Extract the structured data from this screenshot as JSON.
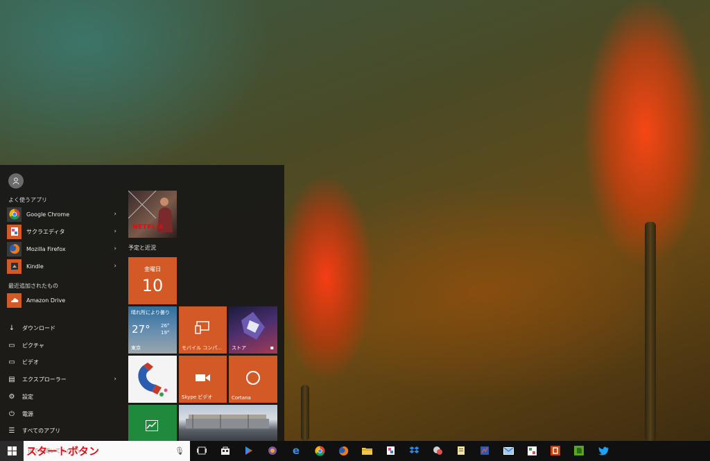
{
  "start_menu": {
    "frequent_label": "よく使うアプリ",
    "frequent_apps": [
      {
        "name": "Google Chrome",
        "icon": "chrome-icon"
      },
      {
        "name": "サクラエディタ",
        "icon": "sakura-editor-icon"
      },
      {
        "name": "Mozilla Firefox",
        "icon": "firefox-icon"
      },
      {
        "name": "Kindle",
        "icon": "kindle-icon"
      }
    ],
    "recent_label": "最近追加されたもの",
    "recent_apps": [
      {
        "name": "Amazon Drive",
        "icon": "amazon-drive-icon"
      }
    ],
    "places": [
      {
        "name": "ダウンロード",
        "icon": "download-icon"
      },
      {
        "name": "ピクチャ",
        "icon": "pictures-icon"
      },
      {
        "name": "ビデオ",
        "icon": "video-icon"
      },
      {
        "name": "エクスプローラー",
        "icon": "explorer-icon"
      },
      {
        "name": "設定",
        "icon": "settings-gear-icon"
      },
      {
        "name": "電源",
        "icon": "power-icon"
      },
      {
        "name": "すべてのアプリ",
        "icon": "all-apps-icon"
      }
    ]
  },
  "tiles": {
    "netflix_text": "NETFLIX",
    "group_label": "予定と近況",
    "calendar_day": "金曜日",
    "calendar_date": "10",
    "weather_condition": "晴れ所により曇り",
    "weather_temp": "27°",
    "weather_high": "26°",
    "weather_low": "19°",
    "weather_city": "東京",
    "mobile_label": "モバイル コンパ...",
    "store_label": "ストア",
    "skype_label": "Skype ビデオ",
    "cortana_label": "Cortana"
  },
  "taskbar": {
    "search_placeholder": "何でも聞いてください",
    "annotation": "スタートボタン"
  },
  "colors": {
    "accent": "#d35a27",
    "start_bg": "#181818",
    "money_tile": "#1f8a3b",
    "weather_tile": "#2f6f9e"
  }
}
